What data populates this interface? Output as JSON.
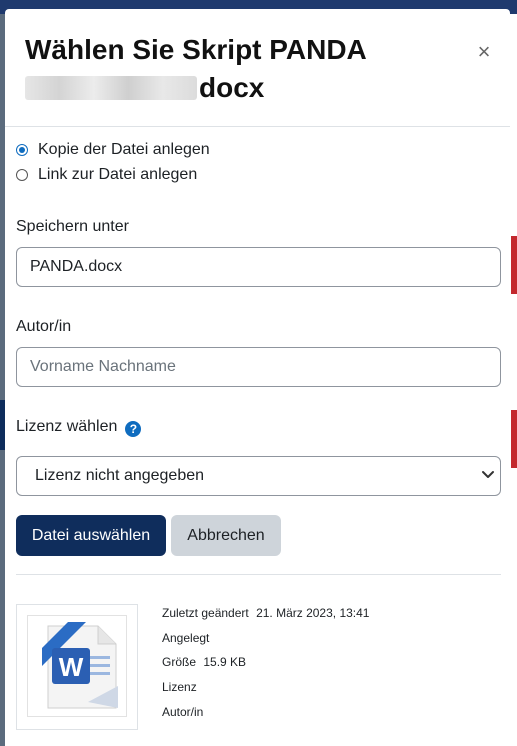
{
  "dialog": {
    "title_line1": "Wählen Sie Skript PANDA",
    "title_line2_suffix": "docx",
    "close_symbol": "×"
  },
  "options": {
    "copy_label": "Kopie der Datei anlegen",
    "link_label": "Link zur Datei anlegen",
    "selected": "copy"
  },
  "save_as": {
    "label": "Speichern unter",
    "value": "PANDA.docx"
  },
  "author": {
    "label": "Autor/in",
    "placeholder": "Vorname Nachname"
  },
  "license": {
    "label": "Lizenz wählen",
    "help_symbol": "?",
    "selected": "Lizenz nicht angegeben"
  },
  "buttons": {
    "select_file": "Datei auswählen",
    "cancel": "Abbrechen"
  },
  "file_info": {
    "last_modified_label": "Zuletzt geändert",
    "last_modified_value": "21. März 2023, 13:41",
    "created_label": "Angelegt",
    "size_label": "Größe",
    "size_value": "15.9 KB",
    "license_label": "Lizenz",
    "author_label": "Autor/in",
    "icon": "word-document-icon"
  },
  "colors": {
    "accent": "#0f6cbf",
    "primary_button": "#0f2d5c",
    "secondary_button": "#ced4da"
  }
}
